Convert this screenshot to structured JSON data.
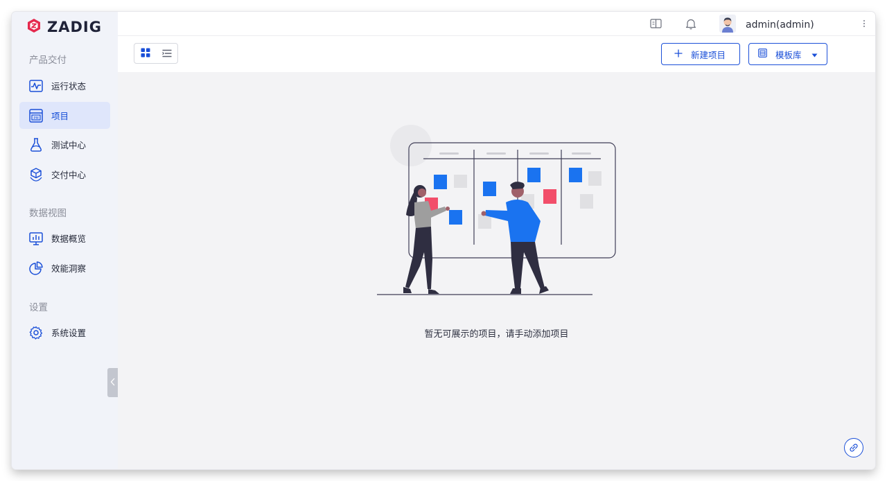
{
  "brand": {
    "name": "ZADIG",
    "logo_color": "#e5294e"
  },
  "sidebar": {
    "sections": [
      {
        "title": "产品交付"
      },
      {
        "title": "数据视图"
      },
      {
        "title": "设置"
      }
    ],
    "items": [
      {
        "label": "运行状态",
        "icon": "pulse-monitor-icon",
        "active": false
      },
      {
        "label": "项目",
        "icon": "pm-board-icon",
        "active": true
      },
      {
        "label": "测试中心",
        "icon": "flask-icon",
        "active": false
      },
      {
        "label": "交付中心",
        "icon": "package-hand-icon",
        "active": false
      },
      {
        "label": "数据概览",
        "icon": "chart-monitor-icon",
        "active": false
      },
      {
        "label": "效能洞察",
        "icon": "pie-chart-icon",
        "active": false
      },
      {
        "label": "系统设置",
        "icon": "gear-icon",
        "active": false
      }
    ],
    "collapse_icon": "chevron-left-icon"
  },
  "header": {
    "docs_icon": "book-icon",
    "notification_icon": "bell-icon",
    "user_name": "admin(admin)",
    "more_icon": "vertical-dots-icon"
  },
  "toolbar": {
    "grid_view_icon": "grid-view-icon",
    "list_view_icon": "list-view-icon",
    "new_project_label": "新建项目",
    "template_label": "模板库"
  },
  "main": {
    "empty_message": "暂无可展示的项目，请手动添加项目",
    "illustration": "kanban-board-people-illustration"
  },
  "colors": {
    "accent": "#1a4fd8",
    "active_bg": "#dfe6fb",
    "card_blue": "#1a73f0",
    "card_pink": "#f24e6a"
  }
}
